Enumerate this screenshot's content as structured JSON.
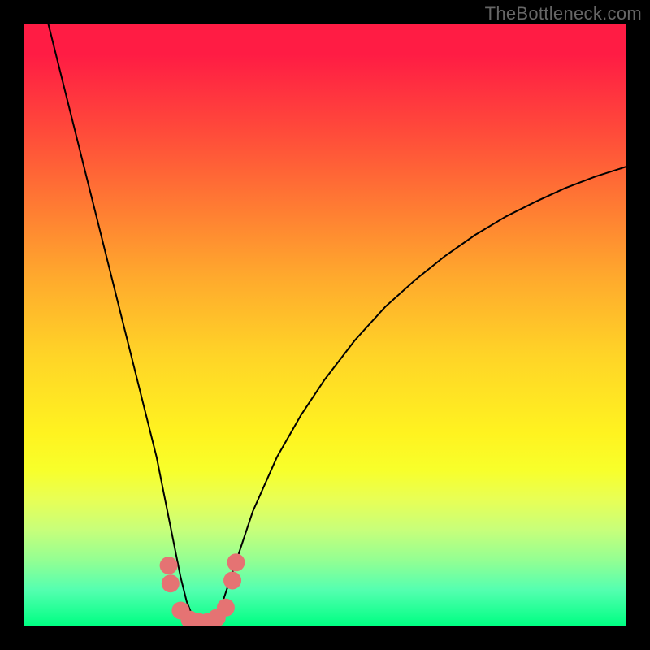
{
  "watermark": "TheBottleneck.com",
  "frame": {
    "outer_w": 800,
    "outer_h": 800,
    "plot_left": 30,
    "plot_top": 30,
    "plot_right": 770,
    "plot_bottom": 770,
    "bg": "#000000"
  },
  "chart_data": {
    "type": "line",
    "title": "",
    "xlabel": "",
    "ylabel": "",
    "xlim": [
      0,
      100
    ],
    "ylim": [
      0,
      100
    ],
    "grid": false,
    "legend": false,
    "annotations": [],
    "series": [
      {
        "name": "curve",
        "color": "#000000",
        "stroke_width": 2,
        "x": [
          4,
          6,
          8,
          10,
          12,
          14,
          16,
          18,
          20,
          22,
          24,
          25,
          26,
          27,
          28,
          29,
          30,
          31,
          32,
          33,
          34,
          36,
          38,
          42,
          46,
          50,
          55,
          60,
          65,
          70,
          75,
          80,
          85,
          90,
          95,
          100
        ],
        "y": [
          100,
          92,
          84,
          76,
          68,
          60,
          52,
          44,
          36,
          28,
          18,
          13,
          8,
          4,
          1.5,
          0.5,
          0.5,
          0.8,
          2,
          4,
          7,
          13,
          19,
          28,
          35,
          41,
          47.5,
          53,
          57.5,
          61.5,
          65,
          68,
          70.5,
          72.8,
          74.7,
          76.3
        ]
      },
      {
        "name": "markers",
        "color": "#e57373",
        "marker_radius": 11,
        "points": [
          {
            "x": 24.0,
            "y": 10.0
          },
          {
            "x": 24.3,
            "y": 7.0
          },
          {
            "x": 26.0,
            "y": 2.5
          },
          {
            "x": 27.5,
            "y": 1.0
          },
          {
            "x": 29.0,
            "y": 0.6
          },
          {
            "x": 30.5,
            "y": 0.6
          },
          {
            "x": 32.0,
            "y": 1.3
          },
          {
            "x": 33.5,
            "y": 3.0
          },
          {
            "x": 34.6,
            "y": 7.5
          },
          {
            "x": 35.2,
            "y": 10.5
          }
        ]
      }
    ]
  }
}
